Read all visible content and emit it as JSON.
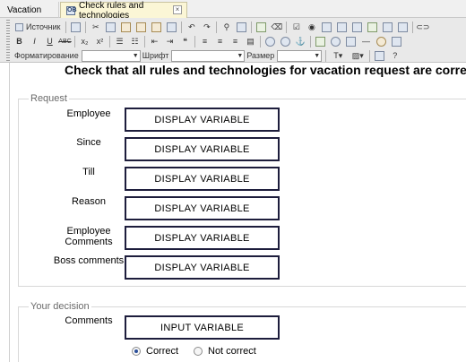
{
  "tabs": [
    {
      "label": "Vacation"
    },
    {
      "label": "Check rules and technologies"
    }
  ],
  "toolbar": {
    "source_label": "Источник",
    "format_label": "Форматирование",
    "font_label": "Шрифт",
    "size_label": "Размер",
    "bold": "B",
    "italic": "I",
    "underline": "U",
    "strike": "ABC",
    "subscript": "x₂",
    "superscript": "x²"
  },
  "form": {
    "title": "Check that all rules and technologies for vacation request are correct",
    "request_legend": "Request",
    "decision_legend": "Your decision",
    "fields": [
      {
        "label": "Employee",
        "value": "DISPLAY VARIABLE"
      },
      {
        "label": "Since",
        "value": "DISPLAY VARIABLE"
      },
      {
        "label": "Till",
        "value": "DISPLAY VARIABLE"
      },
      {
        "label": "Reason",
        "value": "DISPLAY VARIABLE"
      },
      {
        "label": "Employee\nComments",
        "value": "DISPLAY VARIABLE"
      },
      {
        "label": "Boss comments",
        "value": "DISPLAY VARIABLE"
      }
    ],
    "comments_label": "Comments",
    "comments_value": "INPUT VARIABLE",
    "options": [
      {
        "label": "Correct",
        "selected": true
      },
      {
        "label": "Not correct",
        "selected": false
      }
    ]
  }
}
